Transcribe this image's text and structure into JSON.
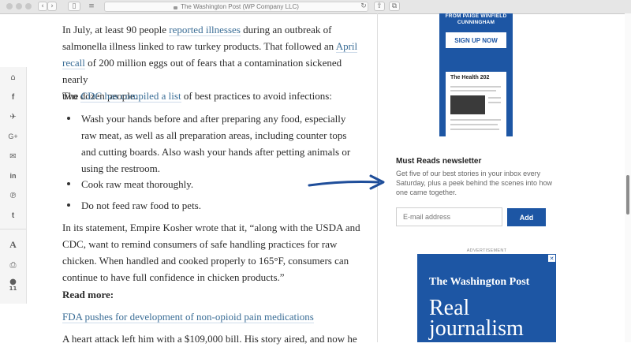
{
  "browser": {
    "url_text": "The Washington Post (WP Company LLC)"
  },
  "rail": {
    "comment_count": "11"
  },
  "article": {
    "p1_a": "In July, at least 90 people ",
    "p1_link1": "reported illnesses",
    "p1_b": " during an outbreak of",
    "p1_c": "salmonella illness linked to raw turkey products. That followed an ",
    "p1_link2a": "April",
    "p1_link2b": "recall",
    "p1_d": " of 200 million eggs out of fears that a contamination sickened nearly",
    "p1_e": "two dozen people.",
    "p2_a": "The ",
    "p2_link": "CDC has compiled a list",
    "p2_b": " of best practices to avoid infections:",
    "bullets": [
      "Wash your hands before and after preparing any food, especially raw meat, as well as all preparation areas, including counter tops and cutting boards. Also wash your hands after petting animals or using the restroom.",
      "Cook raw meat thoroughly.",
      "Do not feed raw food to pets."
    ],
    "p3": "In its statement, Empire Kosher wrote that it, “along with the USDA and CDC, want to remind consumers of safe handling practices for raw chicken. When handled and cooked properly to 165°F, consumers can continue to have full confidence in chicken products.”",
    "read_more": "Read more:",
    "link_fda": "FDA pushes for development of non-opioid pain medications",
    "p4": "A heart attack left him with a $109,000 bill. His story aired, and now he"
  },
  "ad1": {
    "promo": "FROM PAIGE WINFIELD CUNNINGHAM",
    "signup": "SIGN UP NOW",
    "paper_title": "The Health 202"
  },
  "newsletter": {
    "title": "Must Reads newsletter",
    "desc": "Get five of our best stories in your inbox every Saturday, plus a peek behind the scenes into how one came together.",
    "placeholder": "E-mail address",
    "button": "Add"
  },
  "ad2": {
    "label": "ADVERTISEMENT",
    "logo": "The Washington Post",
    "headline1": "Real",
    "headline2": "journalism"
  },
  "colors": {
    "brand_blue": "#1d56a4",
    "link": "#3a6d96",
    "arrow": "#1f4e9a"
  }
}
